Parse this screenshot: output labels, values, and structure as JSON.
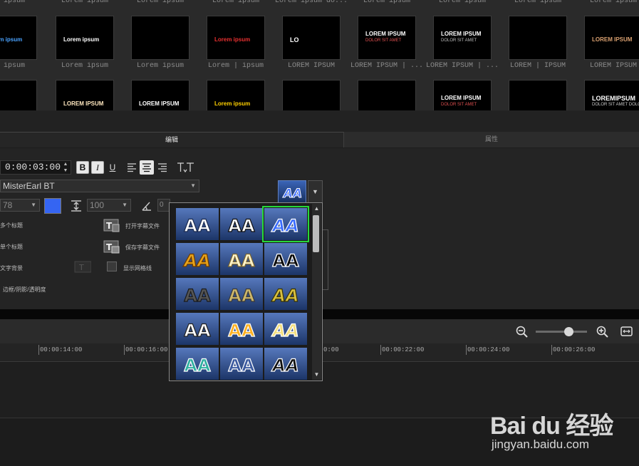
{
  "library": {
    "row1_captions": [
      "em ipsum",
      "Lorem ipsum",
      "Lorem ipsum",
      "Lorem ipsum",
      "Lorem ipsum do...",
      "Lorem ipsum",
      "Lorem ipsum",
      "Lorem ipsum",
      "Lorem ipsum"
    ],
    "row2_captions": [
      "em ipsum",
      "Lorem ipsum",
      "Lorem ipsum",
      "Lorem | ipsum",
      "LOREM IPSUM",
      "LOREM IPSUM | ...",
      "LOREM IPSUM | ...",
      "LOREM | IPSUM",
      "LOREM IPSUM"
    ],
    "thumbs_row1": [
      {
        "text": "Lorem ipsum",
        "color": "#4aa3ff"
      },
      {
        "text": "Lorem ipsum",
        "color": "#ffffff"
      },
      {
        "text": "",
        "color": "#ffffff"
      },
      {
        "text": "Lorem ipsum",
        "color": "#e83030"
      },
      {
        "text": "LO",
        "color": "#ffffff"
      },
      {
        "text": "LOREM IPSUM",
        "sub": "DOLOR SIT AMET",
        "color": "#ffffff",
        "subcolor": "#e05050"
      },
      {
        "text": "LOREM IPSUM",
        "sub": "DOLOR SIT AMET",
        "color": "#ffffff",
        "subcolor": "#bbbbbb"
      },
      {
        "text": "",
        "color": "#ffffff"
      },
      {
        "text": "LOREM IPSUM",
        "color": "#d9a070"
      }
    ],
    "thumbs_row2": [
      {
        "text": "",
        "color": "#e03030"
      },
      {
        "text": "LOREM IPSUM",
        "color": "#ffe8c0"
      },
      {
        "text": "LOREM IPSUM",
        "color": "#ffffff"
      },
      {
        "text": "Lorem ipsum",
        "color": "#ffd000"
      },
      {
        "text": "",
        "color": "#ffffff"
      },
      {
        "text": "",
        "color": "#ffffff"
      },
      {
        "text": "LOREM IPSUM",
        "sub": "DOLOR SIT AMET",
        "color": "#ffffff",
        "subcolor": "#e05050"
      },
      {
        "text": "",
        "color": "#ffffff"
      },
      {
        "text": "LOREMIPSUM",
        "sub": "DOLOR SIT AMET DOLOR SIT AMET",
        "color": "#ffffff",
        "subcolor": "#cccccc"
      }
    ]
  },
  "tabs": {
    "edit": "编辑",
    "properties": "属性"
  },
  "edit": {
    "duration": "0:00:03:00",
    "bold": "B",
    "italic": "I",
    "underline": "U",
    "font": "MisterEarl BT",
    "size": "78",
    "line_spacing": "100",
    "rotation": "0",
    "text_color": "#3565f2",
    "options": {
      "multi_title": "多个标题",
      "single_title": "单个标题",
      "text_background": "文字背景",
      "border_shadow": "边框/阴影/透明度",
      "open_subtitle": "打开字幕文件",
      "save_subtitle": "保存字幕文件",
      "show_grid": "显示网格线"
    }
  },
  "timeline": {
    "ticks": [
      "00:00:14:00",
      "00:00:16:00",
      "0:00",
      "00:00:22:00",
      "00:00:24:00",
      "00:00:26:00"
    ]
  },
  "style_popup": {
    "swatches": [
      {
        "text": "AA",
        "fill": "#ffffff",
        "stroke": "#1a2a50",
        "italic": false
      },
      {
        "text": "AA",
        "fill": "#ffffff",
        "stroke": "#101010",
        "italic": false
      },
      {
        "text": "AA",
        "fill": "#3a6cff",
        "stroke": "#ffffff",
        "italic": true
      },
      {
        "text": "AA",
        "fill": "#e6a21a",
        "stroke": "#6b3a00",
        "italic": true
      },
      {
        "text": "AA",
        "fill": "#fff3c8",
        "stroke": "#7a6530",
        "italic": false
      },
      {
        "text": "AA",
        "fill": "#0b0b0b",
        "stroke": "#ffffff",
        "italic": false
      },
      {
        "text": "AA",
        "fill": "#555555",
        "stroke": "#1a1a1a",
        "italic": false
      },
      {
        "text": "AA",
        "fill": "#cdb76a",
        "stroke": "#3a3a3a",
        "italic": false
      },
      {
        "text": "AA",
        "fill": "#d8c040",
        "stroke": "#3a3300",
        "italic": true
      },
      {
        "text": "AA",
        "fill": "#ffffff",
        "stroke": "#222222",
        "italic": false
      },
      {
        "text": "AA",
        "fill": "#ffb020",
        "stroke": "#ffffff",
        "italic": false
      },
      {
        "text": "AA",
        "fill": "#f4e080",
        "stroke": "#ffffff",
        "italic": true
      },
      {
        "text": "AA",
        "fill": "#2fb0a0",
        "stroke": "#ffffff",
        "italic": false
      },
      {
        "text": "AA",
        "fill": "#3b5aa0",
        "stroke": "#ffffff",
        "italic": false
      },
      {
        "text": "AA",
        "fill": "#111111",
        "stroke": "#ffffff",
        "italic": true
      }
    ]
  },
  "watermark": {
    "logo": "Bai du 经验",
    "url": "jingyan.baidu.com"
  }
}
